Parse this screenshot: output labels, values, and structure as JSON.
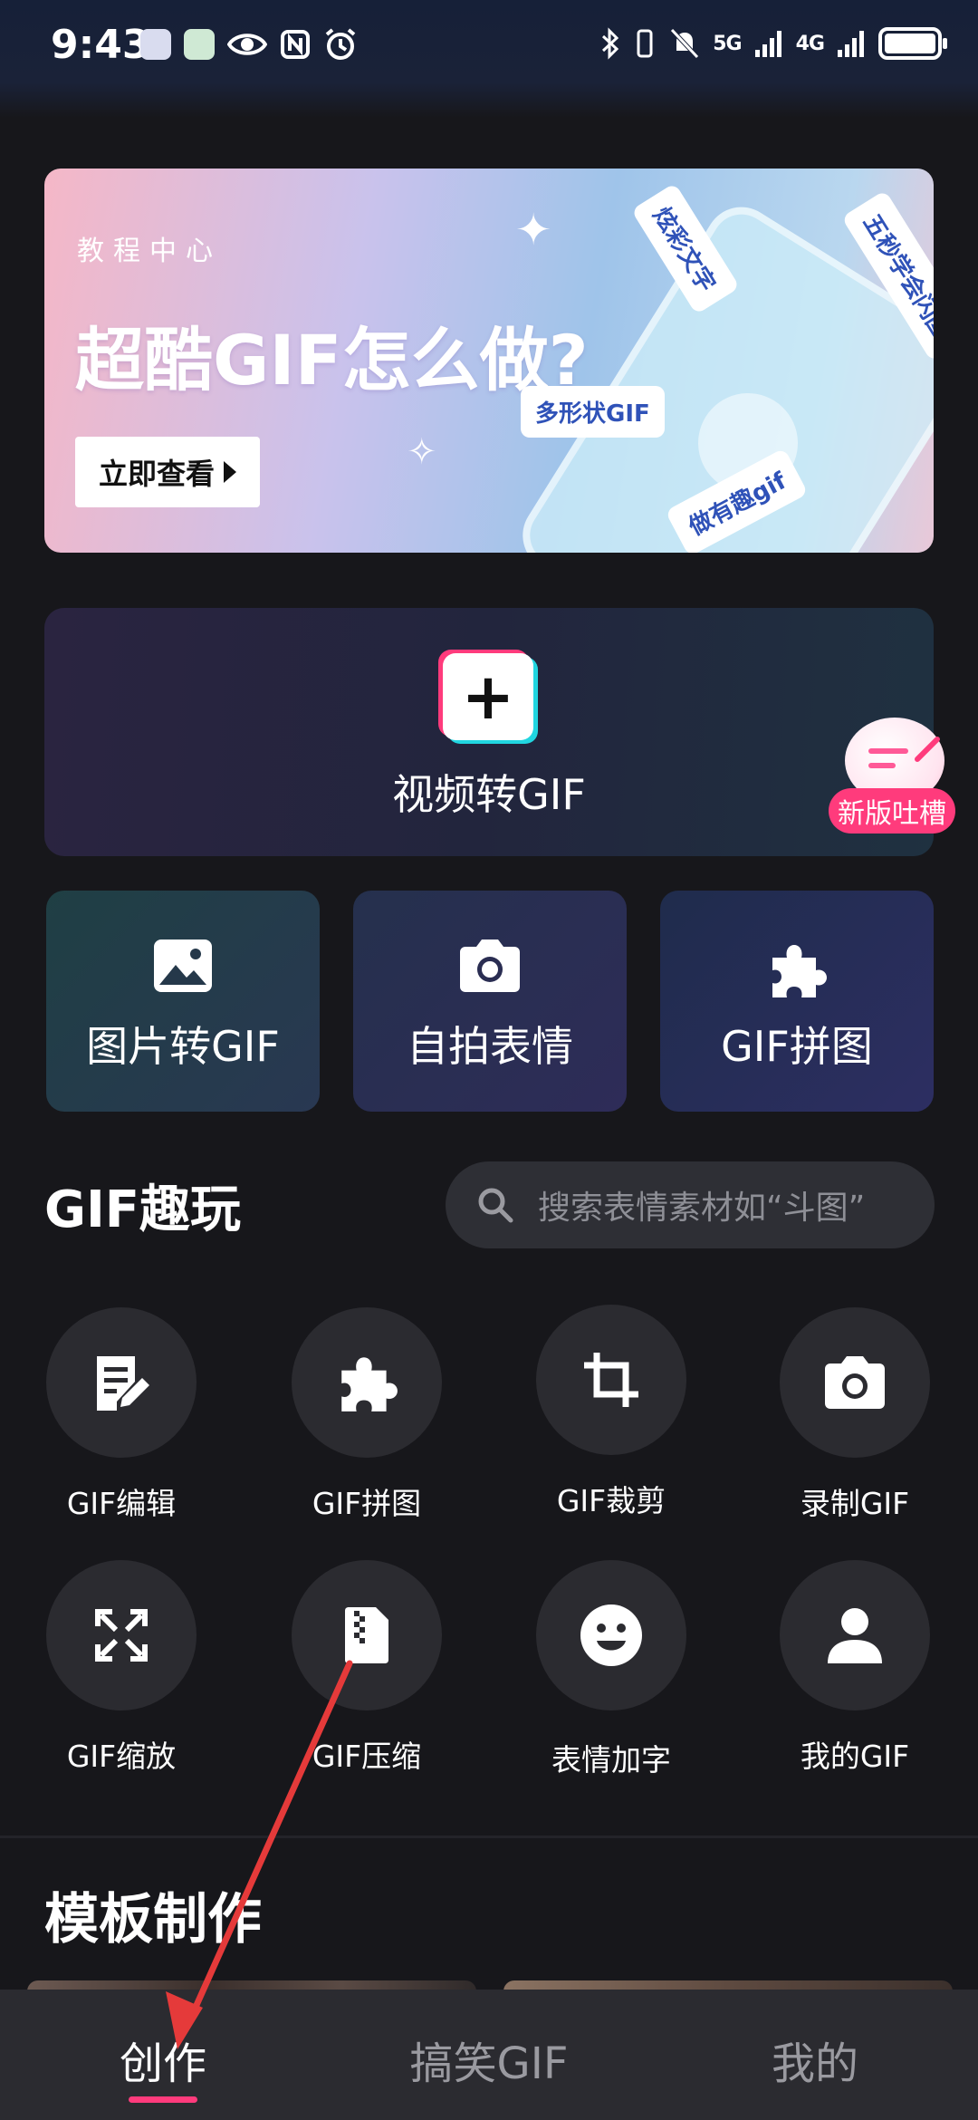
{
  "status_bar": {
    "time": "9:43",
    "signal_1": "5G",
    "signal_2": "4G"
  },
  "banner": {
    "subtitle": "教程中心",
    "title": "超酷GIF怎么做?",
    "button_label": "立即查看",
    "tags": [
      "炫彩文字",
      "五秒学会闪图",
      "多形状GIF",
      "做有趣gif"
    ]
  },
  "video_card": {
    "label": "视频转GIF"
  },
  "feedback": {
    "label": "新版吐槽"
  },
  "tiles": [
    {
      "label": "图片转GIF",
      "icon": "image-icon"
    },
    {
      "label": "自拍表情",
      "icon": "camera-icon"
    },
    {
      "label": "GIF拼图",
      "icon": "puzzle-icon"
    }
  ],
  "fun_section": {
    "title": "GIF趣玩",
    "search_placeholder": "搜索表情素材如“斗图”"
  },
  "tools": [
    {
      "label": "GIF编辑",
      "icon": "edit-note-icon"
    },
    {
      "label": "GIF拼图",
      "icon": "puzzle-icon"
    },
    {
      "label": "GIF裁剪",
      "icon": "crop-icon"
    },
    {
      "label": "录制GIF",
      "icon": "camera-icon"
    },
    {
      "label": "GIF缩放",
      "icon": "expand-icon"
    },
    {
      "label": "GIF压缩",
      "icon": "zip-file-icon"
    },
    {
      "label": "表情加字",
      "icon": "smiley-icon"
    },
    {
      "label": "我的GIF",
      "icon": "person-icon"
    }
  ],
  "template_section": {
    "title": "模板制作"
  },
  "bottom_nav": {
    "items": [
      "创作",
      "搞笑GIF",
      "我的"
    ],
    "active": "创作"
  },
  "colors": {
    "accent_pink": "#ff3b7c",
    "accent_cyan": "#21d6e0",
    "background": "#17171b",
    "annotation_arrow": "#e53a3a"
  }
}
